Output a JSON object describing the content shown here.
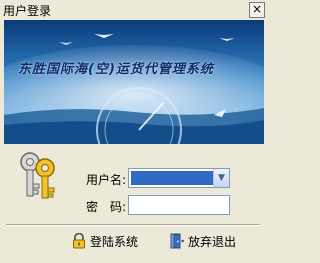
{
  "window": {
    "title": "用户登录",
    "close_glyph": "×"
  },
  "banner": {
    "title": "东胜国际海(空)运货代管理系统"
  },
  "form": {
    "username_label": "用户名:",
    "username_value": "",
    "password_label": "密　码:",
    "password_value": ""
  },
  "actions": {
    "login_label": "登陆系统",
    "cancel_label": "放弃退出"
  },
  "icons": {
    "keys": "keys-icon",
    "lock": "padlock-icon",
    "door": "door-exit-icon",
    "dropdown": "chevron-down-icon"
  }
}
